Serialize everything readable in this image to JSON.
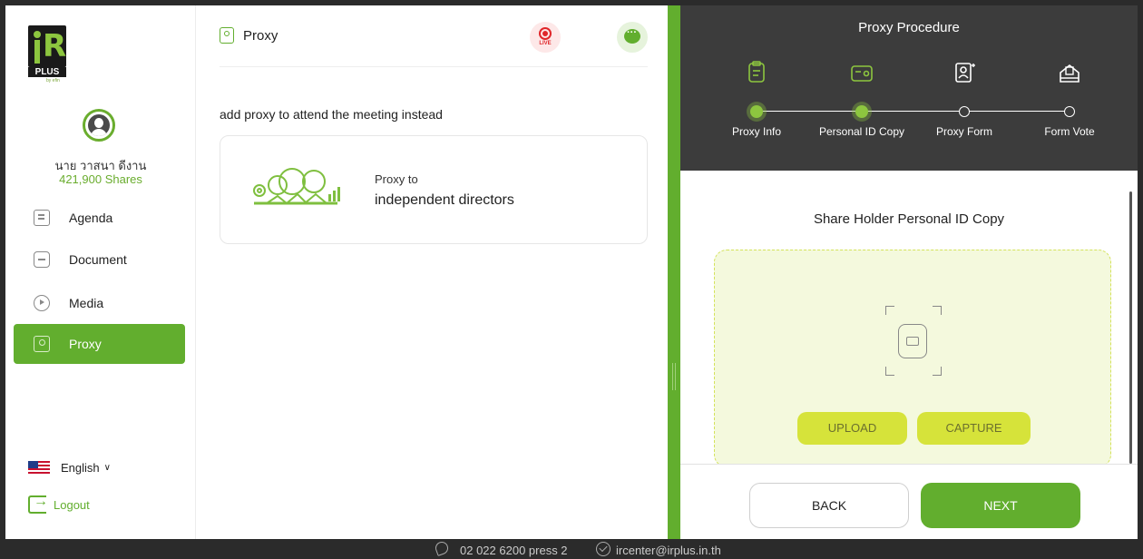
{
  "brand": {
    "logo_text": "iR",
    "logo_sub": "PLUS",
    "logo_by": "by efin"
  },
  "user": {
    "name": "นาย วาสนา ดีงาน",
    "shares": "421,900 Shares"
  },
  "sidebar": {
    "items": [
      {
        "label": "Agenda",
        "icon": "agenda-icon"
      },
      {
        "label": "Document",
        "icon": "document-icon"
      },
      {
        "label": "Media",
        "icon": "media-icon"
      },
      {
        "label": "Proxy",
        "icon": "proxy-icon",
        "active": true
      }
    ],
    "language": "English",
    "logout": "Logout"
  },
  "main": {
    "title": "Proxy",
    "live_label": "LIVE",
    "intro": "add proxy to attend the meeting instead",
    "card": {
      "line1": "Proxy to",
      "line2": "independent directors"
    }
  },
  "panel": {
    "title": "Proxy Procedure",
    "steps": [
      {
        "label": "Proxy Info",
        "status": "done"
      },
      {
        "label": "Personal ID Copy",
        "status": "current"
      },
      {
        "label": "Proxy Form",
        "status": "todo"
      },
      {
        "label": "Form Vote",
        "status": "todo"
      }
    ],
    "section_title": "Share Holder Personal ID Copy",
    "upload_label": "UPLOAD",
    "capture_label": "CAPTURE",
    "back_label": "BACK",
    "next_label": "NEXT"
  },
  "footer": {
    "phone": "02 022 6200 press 2",
    "email": "ircenter@irplus.in.th"
  },
  "colors": {
    "accent": "#62ae2e",
    "dark": "#3c3c3c",
    "upload_zone": "#f4f9dd",
    "button_yellow": "#d6e33a",
    "live_red": "#e0262a"
  }
}
